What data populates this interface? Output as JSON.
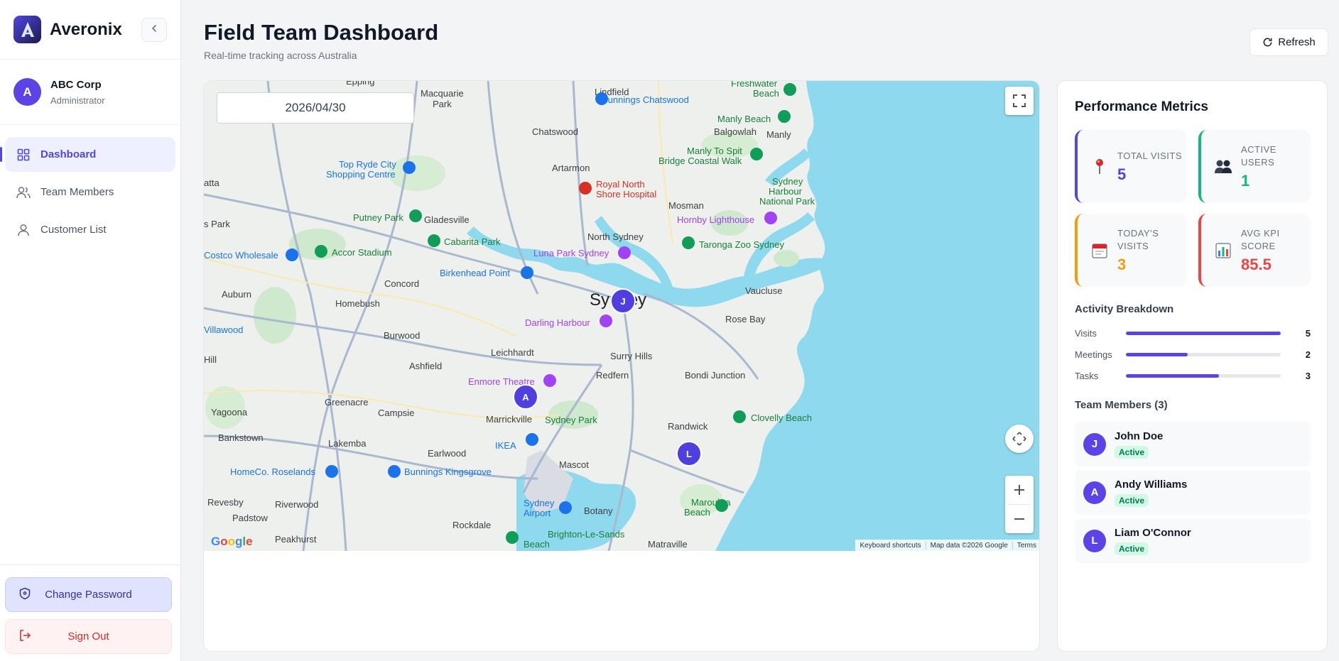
{
  "sidebar": {
    "brand": "Averonix",
    "org": {
      "avatar_letter": "A",
      "name": "ABC Corp",
      "role": "Administrator"
    },
    "nav": [
      {
        "label": "Dashboard",
        "icon": "grid-icon",
        "active": true
      },
      {
        "label": "Team Members",
        "icon": "users-icon",
        "active": false
      },
      {
        "label": "Customer List",
        "icon": "user-icon",
        "active": false
      }
    ],
    "change_password": "Change Password",
    "sign_out": "Sign Out"
  },
  "header": {
    "title": "Field Team Dashboard",
    "subtitle": "Real-time tracking across Australia",
    "refresh": "Refresh"
  },
  "map": {
    "date": "2026/04/30",
    "center_label": "Sydney",
    "footer": {
      "shortcuts": "Keyboard shortcuts",
      "data": "Map data ©2026 Google",
      "terms": "Terms"
    },
    "team_markers": [
      "J",
      "A",
      "L"
    ],
    "places": [
      "Freshwater Beach",
      "Manly Beach",
      "Manly",
      "Balgowlah",
      "Bunnings Chatswood",
      "Lindfield",
      "Macquarie Park",
      "Epping",
      "Chatswood",
      "Artarmon",
      "Royal North Shore Hospital",
      "Manly To Spit Bridge Coastal Walk",
      "Sydney Harbour National Park",
      "Mosman",
      "Top Ryde City Shopping Centre",
      "Putney Park",
      "Gladesville",
      "Cabarita Park",
      "North Sydney",
      "Hornby Lighthouse",
      "Taronga Zoo Sydney",
      "Costco Wholesale",
      "Accor Stadium",
      "Luna Park Sydney",
      "Birkenhead Point",
      "Concord",
      "Auburn",
      "Homebush",
      "Vaucluse",
      "Darling Harbour",
      "Rose Bay",
      "Burwood",
      "Leichhardt",
      "Surry Hills",
      "Ashfield",
      "Redfern",
      "Bondi Junction",
      "Enmore Theatre",
      "Yagoona",
      "Greenacre",
      "Campsie",
      "Marrickville",
      "Sydney Park",
      "Clovelly Beach",
      "Bankstown",
      "Lakemba",
      "Earlwood",
      "IKEA",
      "Randwick",
      "HomeCo. Roselands",
      "Bunnings Kingsgrove",
      "Mascot",
      "Revesby",
      "Riverwood",
      "Padstow",
      "Sydney Airport",
      "Botany",
      "Maroubra Beach",
      "Rockdale",
      "Brighton-Le-Sands Beach",
      "Peakhurst",
      "Matraville",
      "Villawood"
    ]
  },
  "performance": {
    "title": "Performance Metrics",
    "metrics": [
      {
        "label": "TOTAL VISITS",
        "value": "5",
        "color": "#4f46e5",
        "icon": "pin-icon"
      },
      {
        "label": "ACTIVE USERS",
        "value": "1",
        "color": "#10b981",
        "icon": "users-icon"
      },
      {
        "label": "TODAY'S VISITS",
        "value": "3",
        "color": "#f59e0b",
        "icon": "calendar-icon"
      },
      {
        "label": "AVG KPI SCORE",
        "value": "85.5",
        "color": "#ef4444",
        "icon": "bar-chart-icon"
      }
    ],
    "breakdown_title": "Activity Breakdown",
    "breakdown": [
      {
        "label": "Visits",
        "value": "5",
        "fraction": 1.0
      },
      {
        "label": "Meetings",
        "value": "2",
        "fraction": 0.4
      },
      {
        "label": "Tasks",
        "value": "3",
        "fraction": 0.6
      }
    ],
    "team_title": "Team Members (3)",
    "team": [
      {
        "initial": "J",
        "name": "John Doe",
        "status": "Active"
      },
      {
        "initial": "A",
        "name": "Andy Williams",
        "status": "Active"
      },
      {
        "initial": "L",
        "name": "Liam O'Connor",
        "status": "Active"
      }
    ]
  }
}
